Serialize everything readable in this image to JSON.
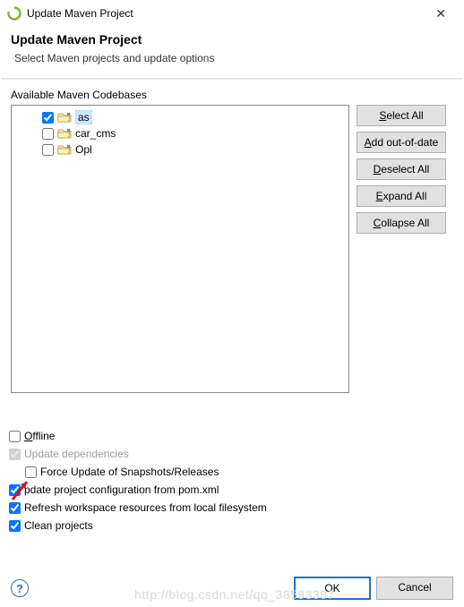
{
  "titlebar": {
    "text": "Update Maven Project"
  },
  "header": {
    "title": "Update Maven Project",
    "subtitle": "Select Maven projects and update options"
  },
  "section_label": "Available Maven Codebases",
  "projects": [
    {
      "label": "as",
      "checked": true,
      "selected": true
    },
    {
      "label": "car_cms",
      "checked": false,
      "selected": false
    },
    {
      "label": "Opl",
      "checked": false,
      "selected": false
    }
  ],
  "buttons": {
    "select_all_pre": "",
    "select_all_u": "S",
    "select_all_post": "elect All",
    "add_ood_pre": "",
    "add_ood_u": "A",
    "add_ood_post": "dd out-of-date",
    "deselect_pre": "",
    "deselect_u": "D",
    "deselect_post": "eselect All",
    "expand_pre": "",
    "expand_u": "E",
    "expand_post": "xpand All",
    "collapse_pre": "",
    "collapse_u": "C",
    "collapse_post": "ollapse All"
  },
  "checks": {
    "offline_u": "O",
    "offline_post": "ffline",
    "offline_checked": false,
    "update_deps_label": "Update dependencies",
    "update_deps_checked": true,
    "update_deps_disabled": true,
    "force_label": "Force Update of Snapshots/Releases",
    "force_checked": false,
    "upd_cfg_first": "",
    "upd_cfg_rest": "pdate project configuration from pom.xml",
    "upd_cfg_checked": true,
    "refresh_label": "Refresh workspace resources from local filesystem",
    "refresh_checked": true,
    "clean_label": "Clean projects",
    "clean_checked": true
  },
  "footer": {
    "ok": "OK",
    "cancel": "Cancel"
  },
  "watermark": "http://blog.csdn.net/qq_38593397"
}
